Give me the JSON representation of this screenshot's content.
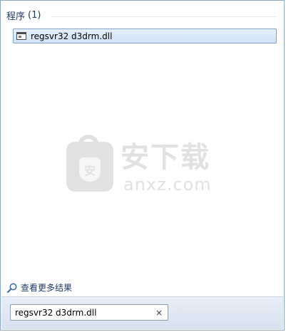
{
  "results": {
    "group_label": "程序",
    "group_count": "(1)",
    "items": [
      {
        "label": "regsvr32 d3drm.dll"
      }
    ]
  },
  "watermark": {
    "cn_text": "安下载",
    "en_text": "anxz.com",
    "shield_char": "安"
  },
  "more_results": {
    "label": "查看更多结果",
    "icon": "search-icon"
  },
  "search": {
    "value": "regsvr32 d3drm.dll",
    "clear_icon": "×"
  },
  "colors": {
    "highlight_border": "#7da2ce",
    "link_text": "#1e3a66"
  }
}
